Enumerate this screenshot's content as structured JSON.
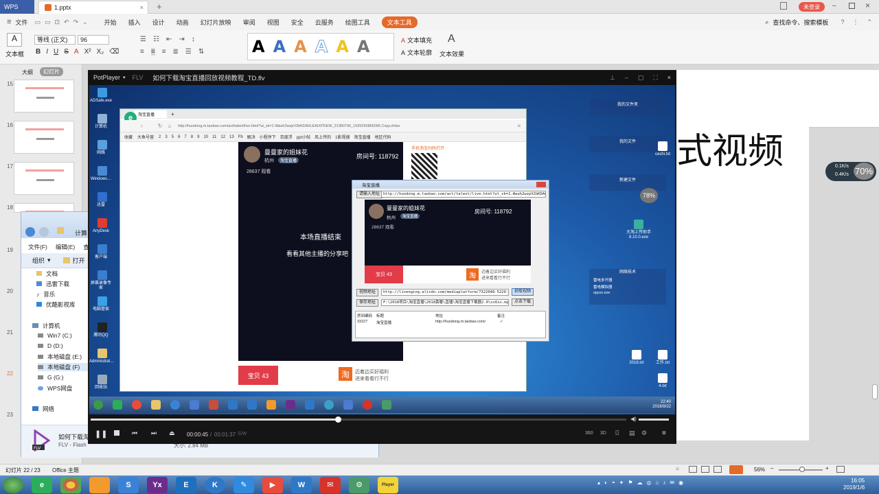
{
  "wps": {
    "app_tab": "WPS",
    "file_tab": "1.pptx",
    "login": "未登录",
    "menu": [
      "文件",
      "开始",
      "插入",
      "设计",
      "动画",
      "幻灯片放映",
      "审阅",
      "视图",
      "安全",
      "云服务",
      "绘图工具",
      "文本工具"
    ],
    "search": "查找命令、搜索模板",
    "font_name": "等线 (正文)",
    "font_size": "96",
    "textbox": "文本框",
    "fill": "文本填充",
    "outline": "文本轮廓",
    "effect": "文本效果",
    "view_tabs": [
      "大纲",
      "幻灯片"
    ],
    "slide_numbers": [
      "15",
      "16",
      "17",
      "18",
      "19",
      "20",
      "21",
      "22",
      "23"
    ],
    "slide_title_text": "式视频",
    "status_left": "幻灯片 22 / 23",
    "status_theme": "Office 主题",
    "zoom": "56%",
    "clock_time": "16:05",
    "clock_date": "2019/1/6"
  },
  "explorer": {
    "crumb": "计算",
    "menu": [
      "文件(F)",
      "编辑(E)",
      "查看"
    ],
    "toolbar": [
      "组织",
      "打开"
    ],
    "tree": [
      "文档",
      "迅雷下载",
      "音乐",
      "优酷影视库",
      "计算机",
      "Win7 (C:)",
      "D (D:)",
      "本地磁盘 (E:)",
      "本地磁盘 (F)",
      "G (G:)",
      "WPS网盘",
      "网络"
    ],
    "file_name": "如何下载淘",
    "file_type": "FLV - Flash",
    "file_size": "大小: 2.84 MB"
  },
  "potplayer": {
    "brand": "PotPlayer",
    "format": "FLV",
    "title": "如何下载淘宝直播回放视频教程_TD.flv",
    "time_cur": "00:00:45",
    "time_total": "00:01:37",
    "codec": "S/W",
    "ctrl_labels": [
      "360",
      "3D"
    ],
    "inner_clock_time": "22:40",
    "inner_clock_date": "2018/9/22"
  },
  "desktop_icons": [
    "ADSafe.exe",
    "计算机",
    "网络",
    "Windows…",
    "迅雷",
    "AnyDesk",
    "客户端",
    "屏幕录像专家",
    "电脑管家",
    "腾讯QQ",
    "Administrat…",
    "回收站",
    "我的文件夹",
    "我的文件",
    "ceshi.txt",
    "新建文件",
    "大淘上传助手 8.10.0.exe",
    "网络技术",
    "雷电多开器",
    "雷电模拟器",
    "spyxx.exe",
    "2018.txt",
    "工作.txt",
    "4.txt"
  ],
  "browser": {
    "tab": "淘宝直播",
    "url": "http://huodong.m.taobao.com/act/talent/live.html?ut_sk=1.Wauh2wzpV2bKDA0LEAIXPDEW_21380790_1535250855096.Copy.zhibo",
    "favorites": [
      "收藏",
      "大鱼号营",
      "2",
      "3",
      "5",
      "6",
      "7",
      "8",
      "9",
      "10",
      "11",
      "12",
      "13",
      "Fb",
      "解决",
      "小程序下",
      "百度浮",
      "ppt小帖",
      "风上传的",
      "1影视搜",
      "淘宝直播",
      "地区代码"
    ],
    "streamer": "曼曼家的姐妹花",
    "city": "杭州",
    "badge": "淘宝直播",
    "room": "房间号: 118792",
    "viewers": "28637 观看",
    "ended": "本场直播结束",
    "others": "看看其他主播的分享吧",
    "baby": "宝贝 43",
    "promo1": "迈着边买好福利",
    "promo2": "进来看看行不行",
    "qr_hint": "手机淘宝扫码打开"
  },
  "dialog": {
    "title": "淘宝直播",
    "req_label": "请输入地址",
    "req_url": "http://huodong.m.taobao.com/act/talent/live.html?ut_sk=1.Wauh2wzpV2bKDA0LEAIXPDEW_21380",
    "video_label": "视频地址",
    "video_url": "http://livenging.alicdn.com/mediaplatform/7322048-5220-4de1-a80e-e56",
    "get_btn": "获取视频",
    "save_label": "保存地址",
    "save_path": "F:\\2018项目\\淘宝直播\\2018黄暖\\直播\\淘宝直播下载器2.0\\vs6ss.mp4",
    "download_btn": "点击下载",
    "cols": [
      "房间编码",
      "标题",
      "地址",
      "备注"
    ],
    "row": [
      "33227",
      "淘宝直播",
      "http://huodong.m.taobao.com/",
      "✓"
    ]
  },
  "widget": {
    "up": "0.1K/s",
    "down": "0.4K/s",
    "pct": "70%",
    "small_pct": "78%"
  },
  "colors": {
    "wps_orange": "#e56a2a",
    "taobao_red": "#e23c48"
  }
}
